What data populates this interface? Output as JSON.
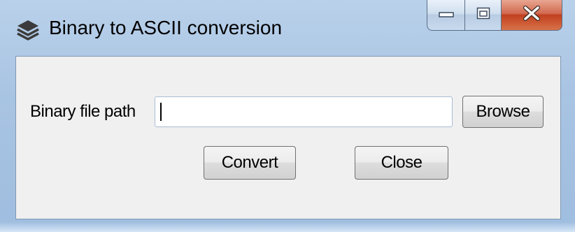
{
  "window": {
    "title": "Binary to ASCII conversion",
    "icons": {
      "app": "stacked-layers-icon",
      "minimize": "minimize-icon",
      "maximize": "maximize-icon",
      "close": "close-icon"
    },
    "colors": {
      "frame": "#a9c4e3",
      "client": "#f0f0f0",
      "close_button": "#c1401f"
    }
  },
  "form": {
    "path_label": "Binary file path",
    "path_value": "",
    "browse_label": "Browse",
    "convert_label": "Convert",
    "close_label": "Close"
  }
}
